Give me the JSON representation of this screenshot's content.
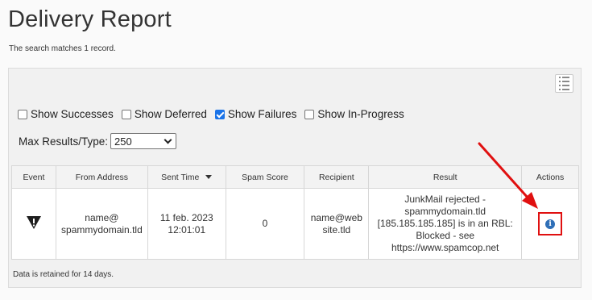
{
  "page": {
    "title": "Delivery Report",
    "subtitle": "The search matches 1 record."
  },
  "toolbar": {
    "list_icon": "list-view-icon"
  },
  "filters": [
    {
      "label": "Show Successes",
      "checked": false
    },
    {
      "label": "Show Deferred",
      "checked": false
    },
    {
      "label": "Show Failures",
      "checked": true
    },
    {
      "label": "Show In-Progress",
      "checked": false
    }
  ],
  "max_results": {
    "label": "Max Results/Type:",
    "value": "250"
  },
  "table": {
    "headers": [
      "Event",
      "From Address",
      "Sent Time",
      "Spam Score",
      "Recipient",
      "Result",
      "Actions"
    ],
    "sorted_column": "Sent Time",
    "rows": [
      {
        "event_icon": "warning-triangle-icon",
        "from_line1": "name@",
        "from_line2": "spammydomain.tld",
        "sent_line1": "11 feb. 2023",
        "sent_line2": "12:01:01",
        "spam_score": "0",
        "recipient_line1": "name@web",
        "recipient_line2": "site.tld",
        "result_lines": [
          "JunkMail rejected -",
          "spammydomain.tld",
          "[185.185.185.185] is in an RBL:",
          "Blocked - see",
          "https://www.spamcop.net"
        ],
        "action_icon": "info-icon"
      }
    ]
  },
  "footer": {
    "note": "Data is retained for 14 days."
  },
  "colors": {
    "accent_checkbox": "#1a73e8",
    "annotation_red": "#e01010",
    "info_blue": "#2f6fb7"
  }
}
